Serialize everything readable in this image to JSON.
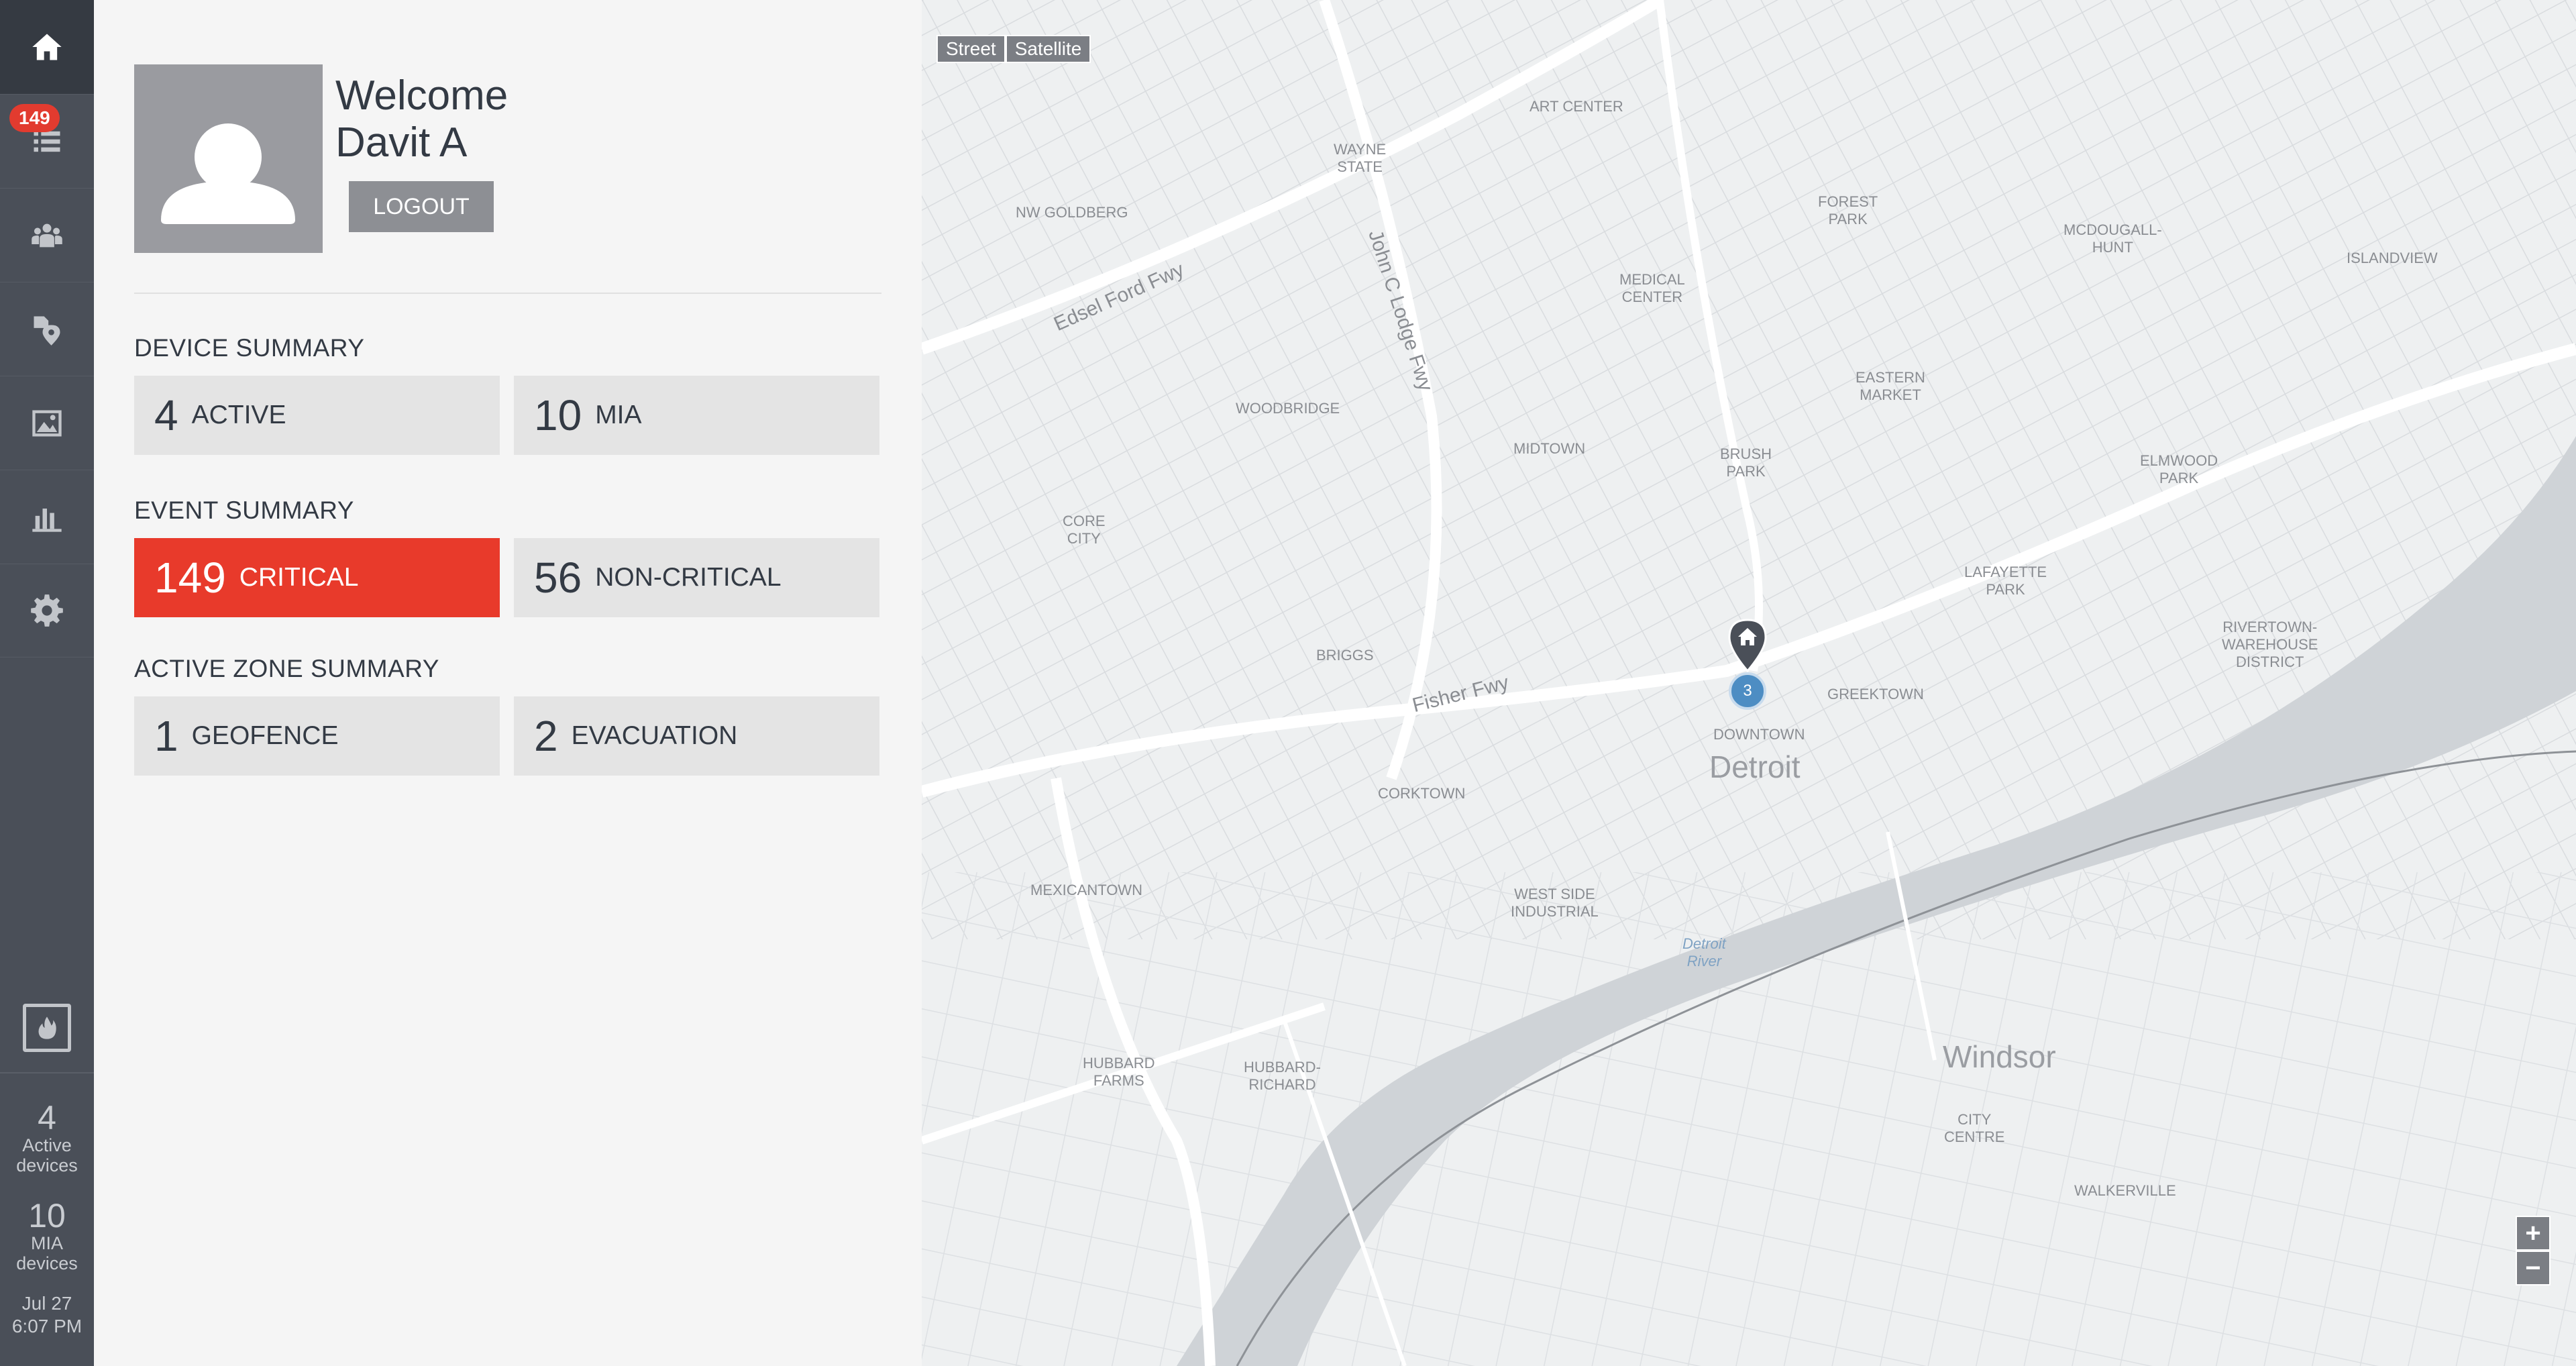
{
  "sidebar": {
    "badge_count": "149",
    "icons": [
      "home-icon",
      "list-icon",
      "group-icon",
      "location-tags-icon",
      "image-icon",
      "bar-chart-icon",
      "gear-icon",
      "fire-icon"
    ],
    "active_devices": {
      "count": "4",
      "label": "Active\ndevices"
    },
    "mia_devices": {
      "count": "10",
      "label": "MIA\ndevices"
    },
    "date": "Jul 27",
    "time": "6:07 PM"
  },
  "user": {
    "greeting": "Welcome",
    "name": "Davit A",
    "logout_label": "LOGOUT"
  },
  "device_summary": {
    "title": "DEVICE SUMMARY",
    "active": {
      "count": "4",
      "label": "ACTIVE"
    },
    "mia": {
      "count": "10",
      "label": "MIA"
    }
  },
  "event_summary": {
    "title": "EVENT SUMMARY",
    "critical": {
      "count": "149",
      "label": "CRITICAL"
    },
    "non_critical": {
      "count": "56",
      "label": "NON-CRITICAL"
    }
  },
  "zone_summary": {
    "title": "ACTIVE ZONE SUMMARY",
    "geofence": {
      "count": "1",
      "label": "GEOFENCE"
    },
    "evacuation": {
      "count": "2",
      "label": "EVACUATION"
    }
  },
  "map": {
    "type_buttons": [
      "Street",
      "Satellite"
    ],
    "zoom_in": "+",
    "zoom_out": "−",
    "cluster_count": "3",
    "labels": {
      "detroit": "Detroit",
      "windsor": "Windsor",
      "downtown": "DOWNTOWN",
      "greektown": "GREEKTOWN",
      "midtown": "MIDTOWN",
      "woodbridge": "WOODBRIDGE",
      "corktown": "CORKTOWN",
      "mexicantown": "MEXICANTOWN",
      "briggs": "BRIGGS",
      "core_city": "CORE\nCITY",
      "brush_park": "BRUSH\nPARK",
      "eastern_market": "EASTERN\nMARKET",
      "lafayette_park": "LAFAYETTE\nPARK",
      "elmwood_park": "ELMWOOD\nPARK",
      "rivertown": "RIVERTOWN-\nWAREHOUSE\nDISTRICT",
      "west_side_industrial": "WEST SIDE\nINDUSTRIAL",
      "hubbard_farms": "HUBBARD\nFARMS",
      "hubbard_richard": "HUBBARD-\nRICHARD",
      "city_centre": "CITY\nCENTRE",
      "walkerville": "WALKERVILLE",
      "islandview": "ISLANDVIEW",
      "forest_park": "FOREST\nPARK",
      "mcdougall_hunt": "MCDOUGALL-\nHUNT",
      "medical_center": "MEDICAL\nCENTER",
      "art_center": "ART CENTER",
      "wayne_state": "WAYNE\nSTATE",
      "nw_goldberg": "NW GOLDBERG",
      "detroit_river": "Detroit\nRiver",
      "fisher_fwy": "Fisher Fwy",
      "edsel_ford_fwy": "Edsel Ford Fwy",
      "lodge_fwy": "John C Lodge Fwy"
    }
  }
}
